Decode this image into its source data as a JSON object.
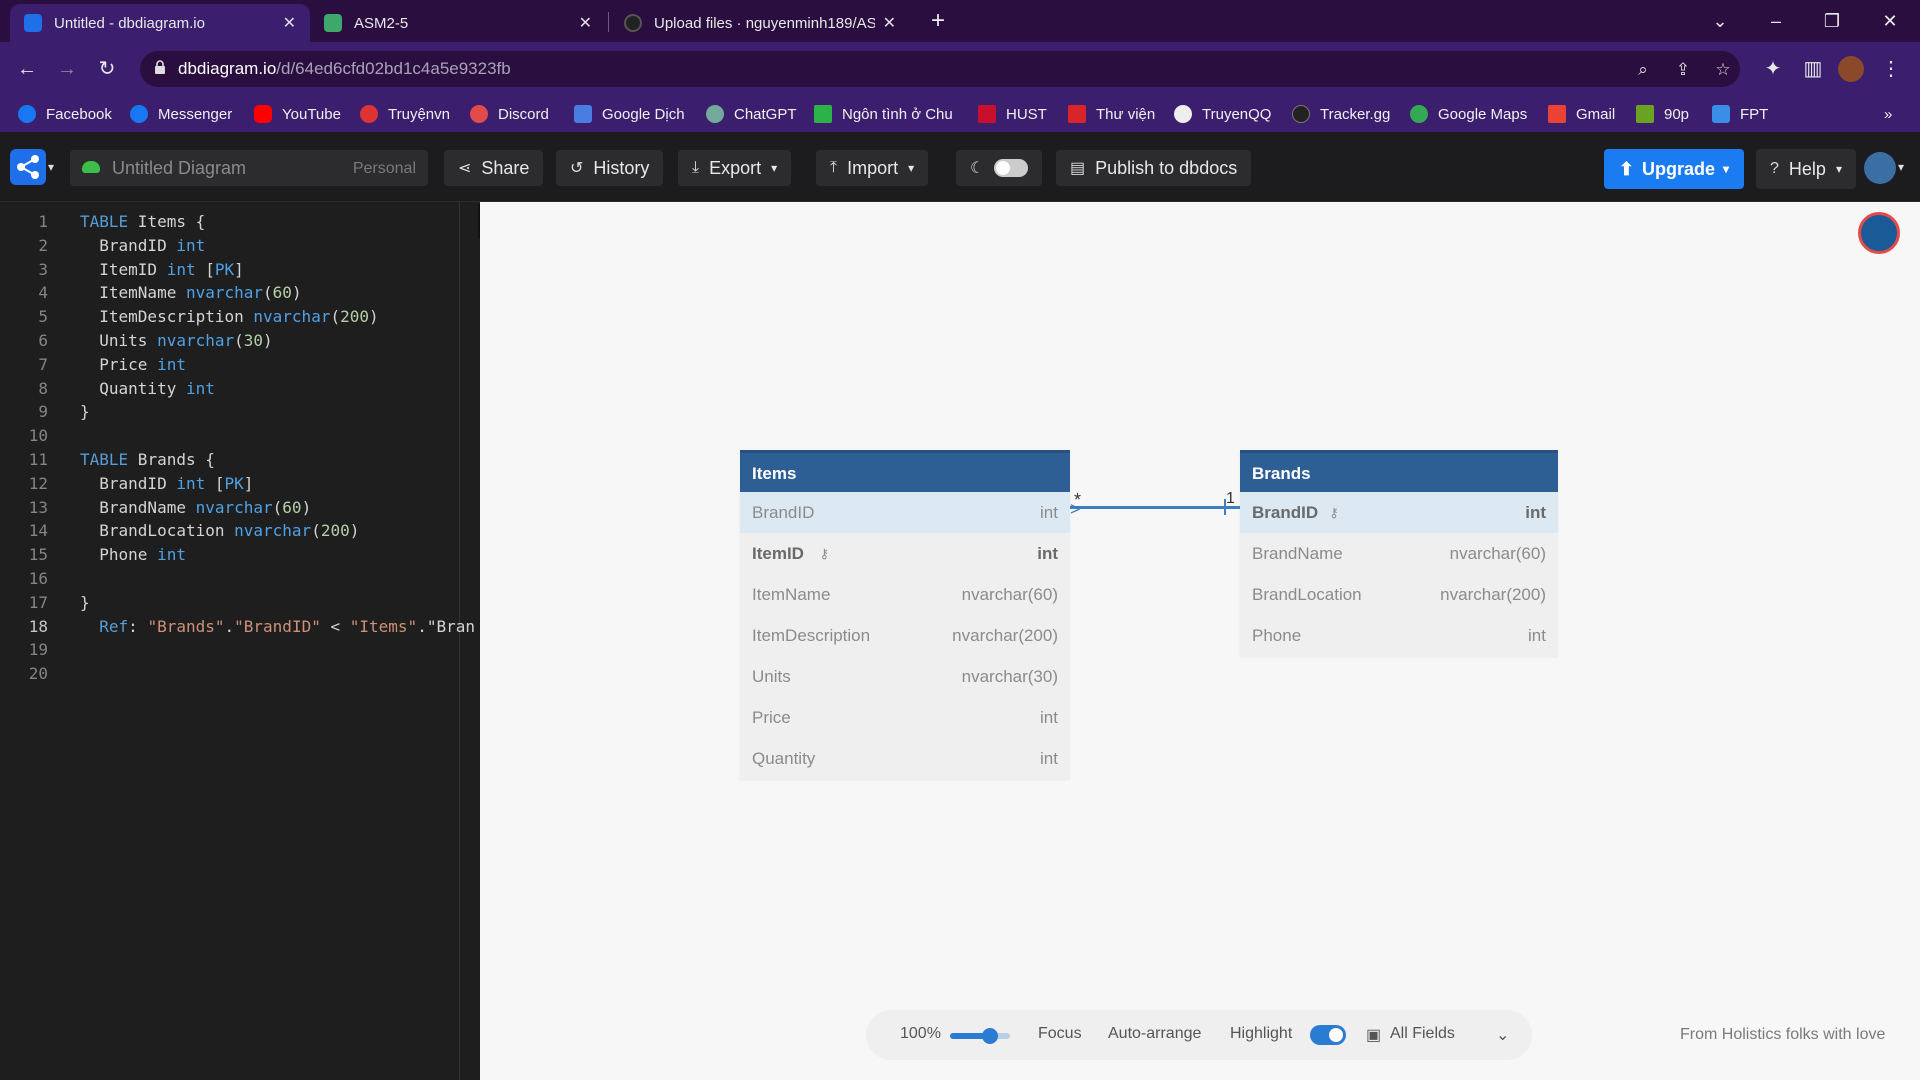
{
  "browser": {
    "tabs": [
      {
        "title": "Untitled - dbdiagram.io",
        "active": true
      },
      {
        "title": "ASM2-5",
        "active": false
      },
      {
        "title": "Upload files · nguyenminh189/AS",
        "active": false
      }
    ],
    "url_host": "dbdiagram.io",
    "url_path": "/d/64ed6cfd02bd1c4a5e9323fb",
    "bookmarks": [
      "Facebook",
      "Messenger",
      "YouTube",
      "Truyệnvn",
      "Discord",
      "Google Dịch",
      "ChatGPT",
      "Ngôn tình ở Chu",
      "HUST",
      "Thư viện",
      "TruyenQQ",
      "Tracker.gg",
      "Google Maps",
      "Gmail",
      "90p",
      "FPT"
    ]
  },
  "toolbar": {
    "diagram_name": "Untitled Diagram",
    "workspace_tag": "Personal",
    "share": "Share",
    "history": "History",
    "export": "Export",
    "import": "Import",
    "publish": "Publish to dbdocs",
    "upgrade": "Upgrade",
    "help": "Help"
  },
  "editor": {
    "current_line": 18,
    "lines": [
      "TABLE Items {",
      "  BrandID int",
      "  ItemID int [PK]",
      "  ItemName nvarchar(60)",
      "  ItemDescription nvarchar(200)",
      "  Units nvarchar(30)",
      "  Price int",
      "  Quantity int",
      "}",
      "",
      "TABLE Brands {",
      "  BrandID int [PK]",
      "  BrandName nvarchar(60)",
      "  BrandLocation nvarchar(200)",
      "  Phone int",
      "",
      "}",
      "  Ref: \"Brands\".\"BrandID\" < \"Items\".\"Bran",
      "",
      ""
    ]
  },
  "diagram": {
    "tables": [
      {
        "name": "Items",
        "fields": [
          {
            "name": "BrandID",
            "type": "int",
            "pk": false,
            "highlight": true
          },
          {
            "name": "ItemID",
            "type": "int",
            "pk": true
          },
          {
            "name": "ItemName",
            "type": "nvarchar(60)",
            "pk": false
          },
          {
            "name": "ItemDescription",
            "type": "nvarchar(200)",
            "pk": false
          },
          {
            "name": "Units",
            "type": "nvarchar(30)",
            "pk": false
          },
          {
            "name": "Price",
            "type": "int",
            "pk": false
          },
          {
            "name": "Quantity",
            "type": "int",
            "pk": false
          }
        ]
      },
      {
        "name": "Brands",
        "fields": [
          {
            "name": "BrandID",
            "type": "int",
            "pk": true,
            "highlight": true
          },
          {
            "name": "BrandName",
            "type": "nvarchar(60)",
            "pk": false
          },
          {
            "name": "BrandLocation",
            "type": "nvarchar(200)",
            "pk": false
          },
          {
            "name": "Phone",
            "type": "int",
            "pk": false
          }
        ]
      }
    ],
    "relation": {
      "many_label": "*",
      "one_label": "1"
    }
  },
  "bottombar": {
    "zoom": "100%",
    "focus": "Focus",
    "auto_arrange": "Auto-arrange",
    "highlight": "Highlight",
    "all_fields": "All Fields"
  },
  "footer": "From Holistics folks with love"
}
